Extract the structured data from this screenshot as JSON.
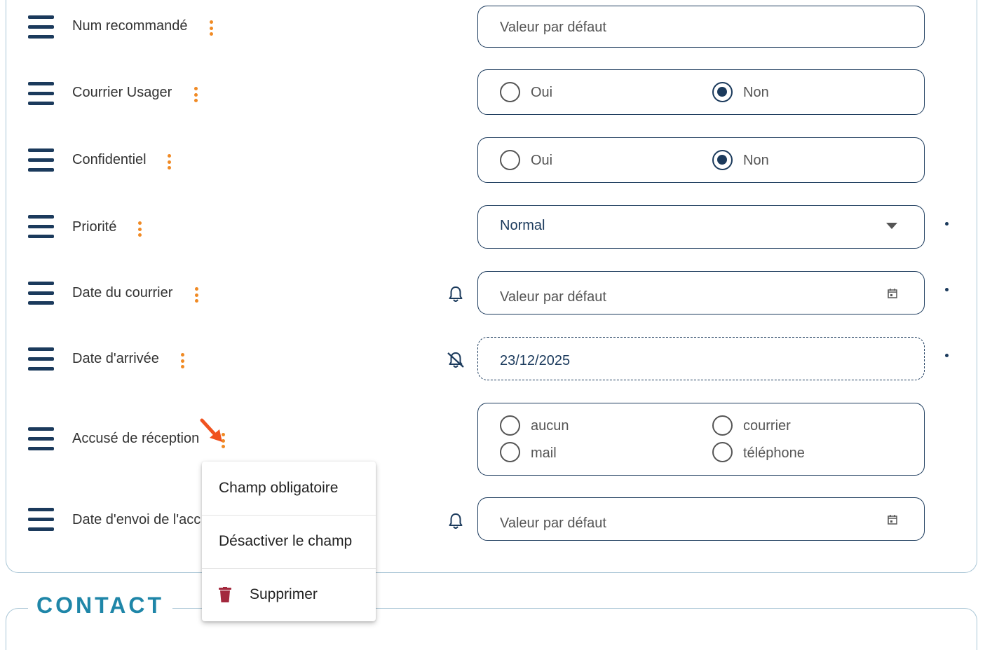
{
  "fields": [
    {
      "label": "Num recommandé",
      "type": "text",
      "placeholder": "Valeur par défaut"
    },
    {
      "label": "Courrier Usager",
      "type": "radio",
      "options": [
        "Oui",
        "Non"
      ],
      "selected": "Non"
    },
    {
      "label": "Confidentiel",
      "type": "radio",
      "options": [
        "Oui",
        "Non"
      ],
      "selected": "Non"
    },
    {
      "label": "Priorité",
      "type": "select",
      "value": "Normal",
      "required": true
    },
    {
      "label": "Date du courrier",
      "type": "date",
      "placeholder": "Valeur par défaut",
      "notification": "on",
      "required": true
    },
    {
      "label": "Date d'arrivée",
      "type": "date",
      "value": "23/12/2025",
      "notification": "off",
      "required": true,
      "disabled": true
    },
    {
      "label": "Accusé de réception",
      "type": "radio-multi",
      "options": [
        "aucun",
        "courrier",
        "mail",
        "téléphone"
      ]
    },
    {
      "label": "Date d'envoi de l'acc",
      "type": "date",
      "placeholder": "Valeur par défaut",
      "notification": "on"
    }
  ],
  "context_menu": {
    "items": [
      "Champ obligatoire",
      "Désactiver le champ",
      "Supprimer"
    ]
  },
  "next_section": {
    "title": "CONTACT"
  },
  "colors": {
    "accent": "#1b3a5c",
    "dots": "#f08a24",
    "section_title": "#1f86a8",
    "delete_icon": "#a3283d",
    "arrow": "#f0521f"
  }
}
